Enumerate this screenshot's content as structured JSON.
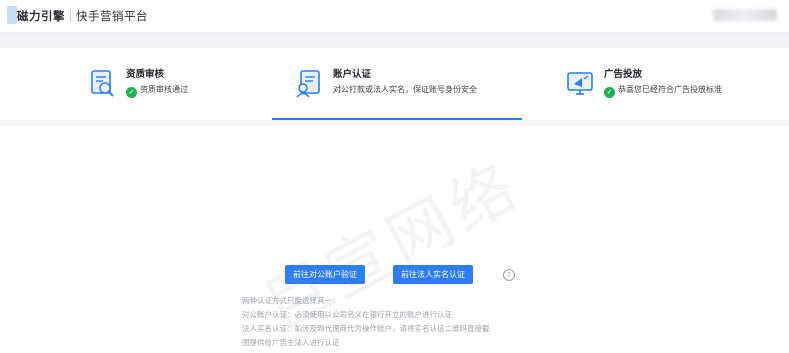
{
  "header": {
    "brand": "磁力引擎",
    "platform": "快手营销平台"
  },
  "steps": [
    {
      "title": "资质审核",
      "desc": "资质审核通过",
      "status": "done",
      "icon": "document-search-icon"
    },
    {
      "title": "账户认证",
      "desc": "对公打款或法人实名，保证账号身份安全",
      "status": "active",
      "icon": "account-verify-icon"
    },
    {
      "title": "广告投放",
      "desc": "恭喜您已经符合广告投放标准",
      "status": "done",
      "icon": "ad-launch-icon"
    }
  ],
  "colors": {
    "accent": "#2e7cf6",
    "success": "#1fb14f"
  },
  "actions": {
    "corporate_btn": "前往对公账户验证",
    "legal_btn": "前往法人实名认证"
  },
  "notes": [
    "两种认证方式只能选择其一：",
    "对公账户认证：必须使用以公司名义在银行开立的账户进行认证",
    "法人实名认证：如涉及到代理商代为操作账户，请将实名认证二维码直接截",
    "图提供给广告主法人进行认证"
  ],
  "watermark": "巨宣网络"
}
